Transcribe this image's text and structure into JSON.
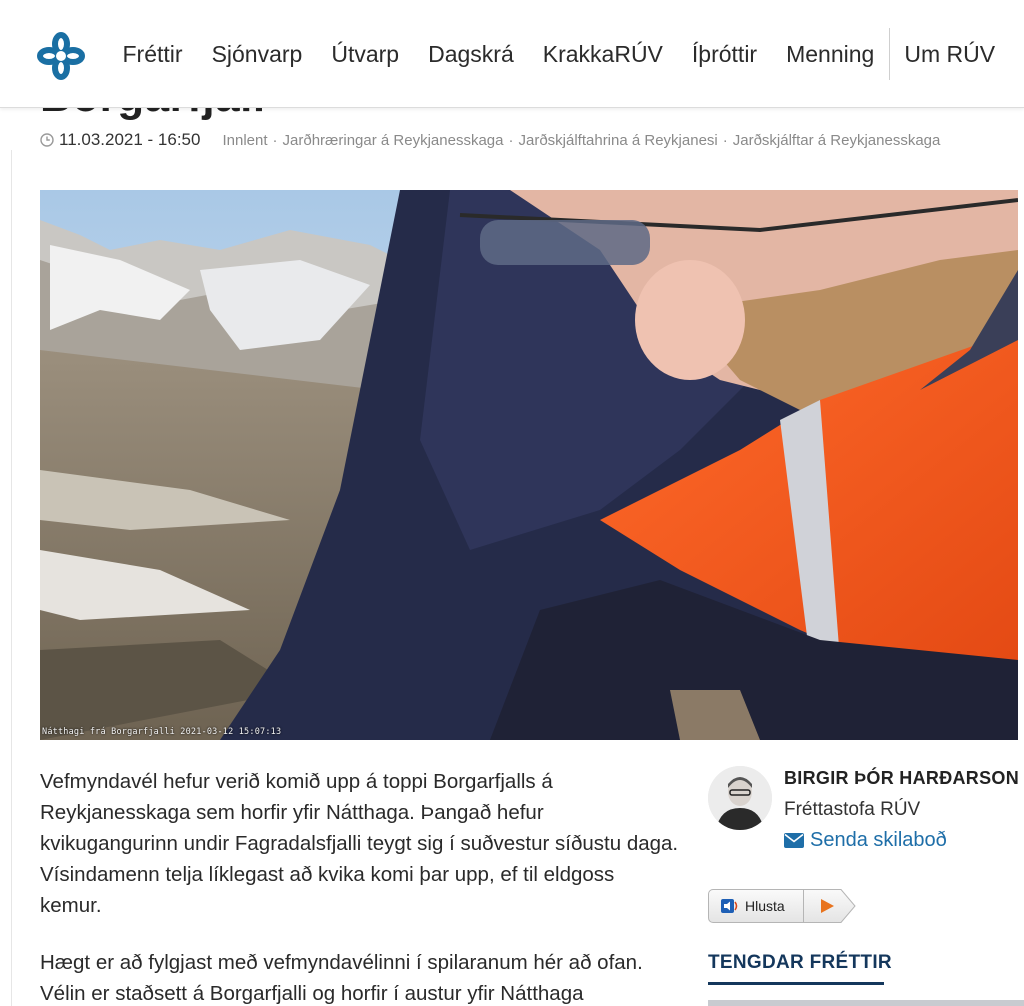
{
  "nav": {
    "items": [
      "Fréttir",
      "Sjónvarp",
      "Útvarp",
      "Dagskrá",
      "KrakkaRÚV",
      "Íþróttir",
      "Menning",
      "Um RÚV"
    ]
  },
  "article": {
    "title_fragment": "Borgarfjall",
    "date": "11.03.2021 - 16:50",
    "tags": [
      "Innlent",
      "Jarðhræringar á Reykjanesskaga",
      "Jarðskjálftahrina á Reykjanesi",
      "Jarðskjálftar á Reykjanesskaga"
    ],
    "video_caption": "Nátthagi frá Borgarfjalli 2021-03-12 15:07:13",
    "paragraphs": [
      "Vefmyndavél hefur verið komið upp á toppi Borgarfjalls á Reykjanesskaga sem horfir yfir Nátthaga. Þangað hefur kvikugangurinn undir Fagradalsfjalli teygt sig í suðvestur síðustu daga. Vísindamenn telja líklegast að kvika komi þar upp, ef til eldgoss kemur.",
      "Hægt er að fylgjast með vefmyndavélinni í spilaranum hér að ofan. Vélin er staðsett á Borgarfjalli og horfir í austur yfir Nátthaga"
    ]
  },
  "author": {
    "name": "BIRGIR ÞÓR HARÐARSON",
    "org": "Fréttastofa RÚV",
    "message": "Senda skilaboð"
  },
  "listen": {
    "label": "Hlusta"
  },
  "related": {
    "title": "TENGDAR FRÉTTIR"
  },
  "colors": {
    "link": "#1e6ea8",
    "related": "#14375c",
    "brand": "#1a6fa3",
    "play": "#e8731d"
  }
}
